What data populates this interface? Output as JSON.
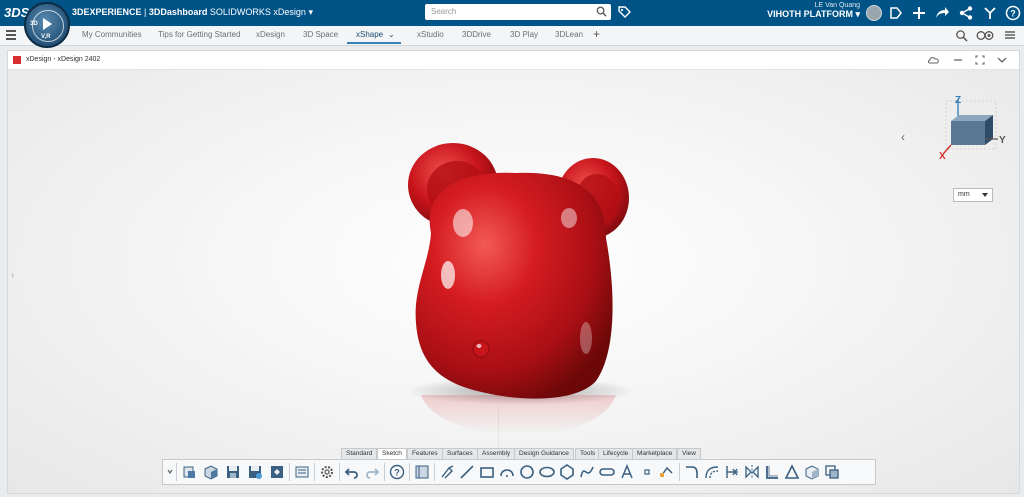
{
  "topbar": {
    "brand_3dx": "3DEXPERIENCE",
    "brand_sep": " | ",
    "brand_dashboard": "3DDashboard",
    "brand_app": "SOLIDWORKS xDesign",
    "compass_3d": "3D",
    "compass_vr": "V,R",
    "search_placeholder": "Search",
    "user_name": "LE Van Quang",
    "platform": "VIHOTH PLATFORM"
  },
  "tabs": [
    {
      "label": "My Communities"
    },
    {
      "label": "Tips for Getting Started"
    },
    {
      "label": "xDesign"
    },
    {
      "label": "3D Space"
    },
    {
      "label": "xShape"
    },
    {
      "label": "xStudio"
    },
    {
      "label": "3DDrive"
    },
    {
      "label": "3D Play"
    },
    {
      "label": "3DLean"
    }
  ],
  "active_tab": "xShape",
  "widget": {
    "title": "xDesign - xDesign 2402",
    "units": "mm",
    "axis_z": "Z",
    "axis_y": "Y",
    "axis_x": "X"
  },
  "command_tabs": [
    {
      "label": "Standard"
    },
    {
      "label": "Sketch"
    },
    {
      "label": "Features"
    },
    {
      "label": "Surfaces"
    },
    {
      "label": "Assembly"
    },
    {
      "label": "Design Guidance"
    },
    {
      "label": "Tools"
    },
    {
      "label": "Lifecycle"
    },
    {
      "label": "Marketplace"
    },
    {
      "label": "View"
    }
  ],
  "colors": {
    "topbar": "#005386",
    "model": "#c8141b",
    "active_tab": "#3680b8"
  }
}
